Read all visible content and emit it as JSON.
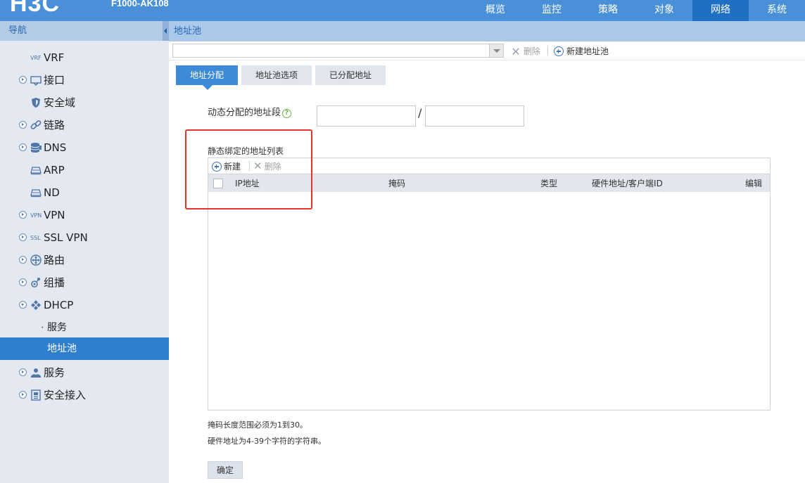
{
  "header": {
    "logo": "H3C",
    "model": "F1000-AK108",
    "tabs": [
      {
        "label": "概览"
      },
      {
        "label": "监控"
      },
      {
        "label": "策略"
      },
      {
        "label": "对象"
      },
      {
        "label": "网络",
        "active": true
      },
      {
        "label": "系统"
      }
    ]
  },
  "sidebar": {
    "title": "导航",
    "items": [
      {
        "label": "VRF",
        "icon": "vrf-icon"
      },
      {
        "label": "接口",
        "icon": "interface-icon"
      },
      {
        "label": "安全域",
        "icon": "shield-icon"
      },
      {
        "label": "链路",
        "icon": "link-icon"
      },
      {
        "label": "DNS",
        "icon": "database-icon"
      },
      {
        "label": "ARP",
        "icon": "arp-icon"
      },
      {
        "label": "ND",
        "icon": "nd-icon"
      },
      {
        "label": "VPN",
        "icon": "vpn-icon"
      },
      {
        "label": "SSL VPN",
        "icon": "ssl-vpn-icon"
      },
      {
        "label": "路由",
        "icon": "routing-icon"
      },
      {
        "label": "组播",
        "icon": "multicast-icon"
      },
      {
        "label": "DHCP",
        "icon": "dhcp-icon"
      },
      {
        "label": "服务"
      },
      {
        "label": "地址池",
        "active": true
      },
      {
        "label": "服务",
        "icon": "service-icon"
      },
      {
        "label": "安全接入",
        "icon": "secure-access-icon"
      }
    ]
  },
  "main": {
    "breadcrumb": "地址池",
    "toolbar": {
      "combo_value": "",
      "delete_label": "删除",
      "new_pool_label": "新建地址池"
    },
    "tabs": [
      {
        "label": "地址分配",
        "active": true
      },
      {
        "label": "地址池选项"
      },
      {
        "label": "已分配地址"
      }
    ],
    "dynamic_range": {
      "label": "动态分配的地址段",
      "help": "?",
      "separator": "/",
      "start_value": "",
      "end_value": ""
    },
    "static_list": {
      "label": "静态绑定的地址列表",
      "new_label": "新建",
      "delete_label": "删除",
      "columns": [
        "IP地址",
        "掩码",
        "类型",
        "硬件地址/客户端ID",
        "编辑"
      ],
      "rows": []
    },
    "notes": [
      "掩码长度范围必须为1到30。",
      "硬件地址为4-39个字符的字符串。"
    ],
    "confirm_label": "确定"
  },
  "colors": {
    "header_blue": "#4a90d9",
    "active_blue": "#2f7fd1",
    "highlight_red": "#e5322d"
  }
}
